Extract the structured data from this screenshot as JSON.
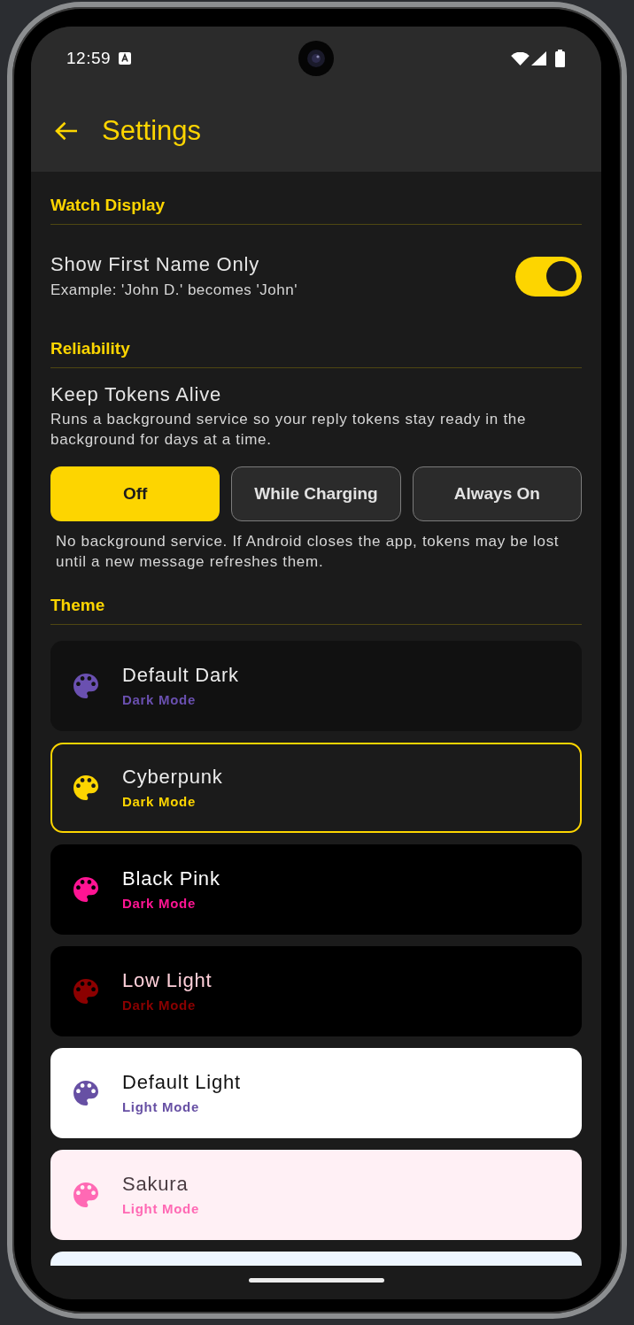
{
  "status_bar": {
    "time": "12:59"
  },
  "app_bar": {
    "title": "Settings"
  },
  "sections": [
    {
      "kind": "toggle",
      "title": "Watch Display",
      "label": "Show First Name Only",
      "description": "Example: 'John D.' becomes 'John'",
      "on": true
    },
    {
      "kind": "choice",
      "title": "Reliability",
      "label": "Keep Tokens Alive",
      "description": "Runs a background service so your reply tokens stay ready in the background for days at a time.",
      "options": [
        {
          "label": "Off",
          "selected": true
        },
        {
          "label": "While Charging",
          "selected": false
        },
        {
          "label": "Always On",
          "selected": false
        }
      ],
      "note": "No background service. If Android closes the app, tokens may be lost until a new message refreshes them."
    },
    {
      "kind": "themes",
      "title": "Theme",
      "themes": [
        {
          "kind": "charcoal",
          "name": "Default Dark",
          "mode": "Dark Mode",
          "color": "#6a50b0",
          "selected": false
        },
        {
          "kind": "graphite",
          "name": "Cyberpunk",
          "mode": "Dark Mode",
          "color": "#fdd500",
          "selected": true
        },
        {
          "kind": "black",
          "name": "Black Pink",
          "mode": "Dark Mode",
          "color": "#ff1493",
          "selected": false
        },
        {
          "kind": "dim",
          "name": "Low Light",
          "mode": "Dark Mode",
          "color": "#8b0000",
          "selected": false
        },
        {
          "kind": "white",
          "name": "Default Light",
          "mode": "Light Mode",
          "color": "#6750a4",
          "selected": false
        },
        {
          "kind": "blush",
          "name": "Sakura",
          "mode": "Light Mode",
          "color": "#ff69b4",
          "selected": false
        },
        {
          "kind": "ice",
          "selected": false
        }
      ]
    }
  ]
}
